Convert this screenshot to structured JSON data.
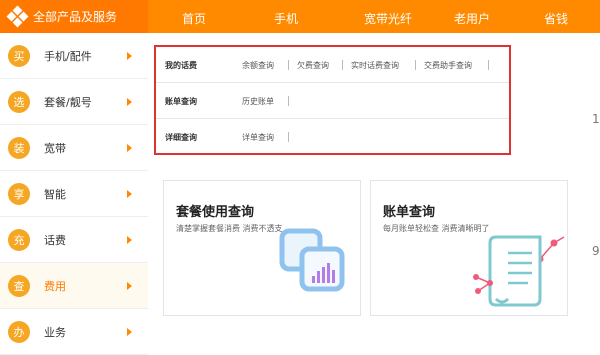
{
  "header": {
    "category_title": "全部产品及服务",
    "nav": [
      "首页",
      "手机",
      "宽带光纤",
      "老用户",
      "省钱"
    ]
  },
  "sidebar": {
    "items": [
      {
        "badge": "买",
        "label": "手机/配件"
      },
      {
        "badge": "选",
        "label": "套餐/靓号"
      },
      {
        "badge": "装",
        "label": "宽带"
      },
      {
        "badge": "享",
        "label": "智能"
      },
      {
        "badge": "充",
        "label": "话费"
      },
      {
        "badge": "查",
        "label": "费用"
      },
      {
        "badge": "办",
        "label": "业务"
      }
    ],
    "active_index": 5
  },
  "menu": {
    "rows": [
      {
        "title": "我的话费",
        "links": [
          "余额查询",
          "欠费查询",
          "实时话费查询",
          "交费助手查询"
        ]
      },
      {
        "title": "账单查询",
        "links": [
          "历史账单"
        ]
      },
      {
        "title": "详细查询",
        "links": [
          "详单查询"
        ]
      }
    ]
  },
  "cards": [
    {
      "title": "套餐使用查询",
      "desc": "清楚掌握套餐消费 消费不透支",
      "icon": "package-usage-icon"
    },
    {
      "title": "账单查询",
      "desc": "每月账单轻松查 消费清晰明了",
      "icon": "bill-scroll-icon"
    }
  ],
  "edge_fragments": [
    "1",
    "9"
  ],
  "colors": {
    "accent": "#ff8a00",
    "badge": "#f5a623",
    "highlight_border": "#dd3333",
    "card_icon_blue": "#8fc3ee",
    "card_icon_purple": "#b57be6",
    "card_icon_pink": "#ef5b7b"
  }
}
